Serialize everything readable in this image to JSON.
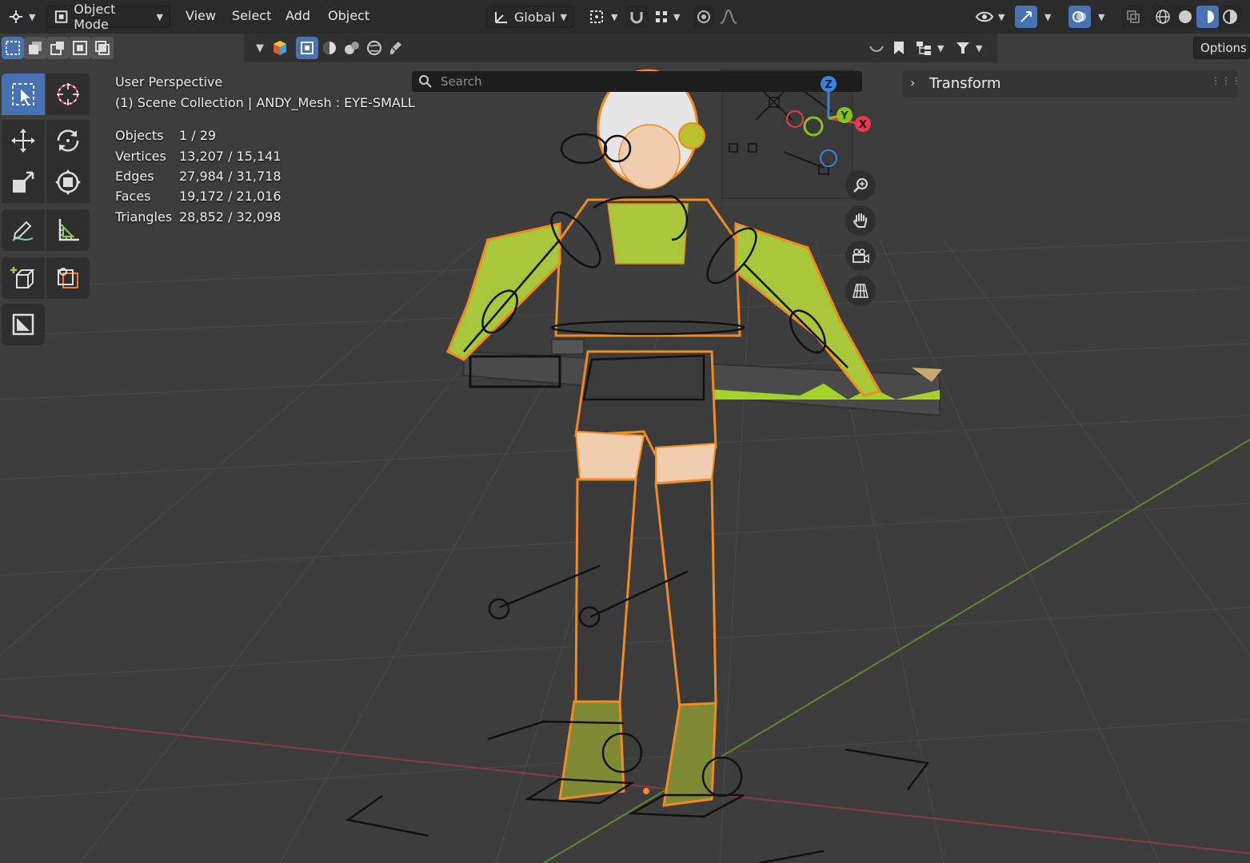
{
  "header": {
    "mode_label": "Object Mode",
    "menus": [
      "View",
      "Select",
      "Add",
      "Object"
    ],
    "orientation_label": "Global",
    "options_label": "Options"
  },
  "search": {
    "placeholder": "Search"
  },
  "viewport": {
    "view_name": "User Perspective",
    "collection_info": "(1) Scene Collection | ANDY_Mesh : EYE-SMALL",
    "stats": [
      {
        "label": "Objects",
        "value": "1 / 29"
      },
      {
        "label": "Vertices",
        "value": "13,207 / 15,141"
      },
      {
        "label": "Edges",
        "value": "27,984 / 31,718"
      },
      {
        "label": "Faces",
        "value": "19,172 / 21,016"
      },
      {
        "label": "Triangles",
        "value": "28,852 / 32,098"
      }
    ]
  },
  "sidebar": {
    "panel_title": "Transform"
  },
  "gizmo": {
    "x": "X",
    "y": "Y",
    "z": "Z"
  },
  "colors": {
    "accent": "#4772b3",
    "selection": "#f28a20",
    "axis_x": "#e23a4e",
    "axis_y": "#89c31a",
    "axis_z": "#3c82d6"
  },
  "icons": {
    "tools": [
      "select-box-icon",
      "cursor-icon",
      "move-icon",
      "rotate-icon",
      "scale-icon",
      "transform-icon",
      "annotate-icon",
      "measure-icon",
      "add-cube-icon",
      "object-origin-icon",
      "extra-tool-icon"
    ],
    "navigation": [
      "zoom-icon",
      "pan-hand-icon",
      "camera-icon",
      "grid-icon"
    ]
  }
}
